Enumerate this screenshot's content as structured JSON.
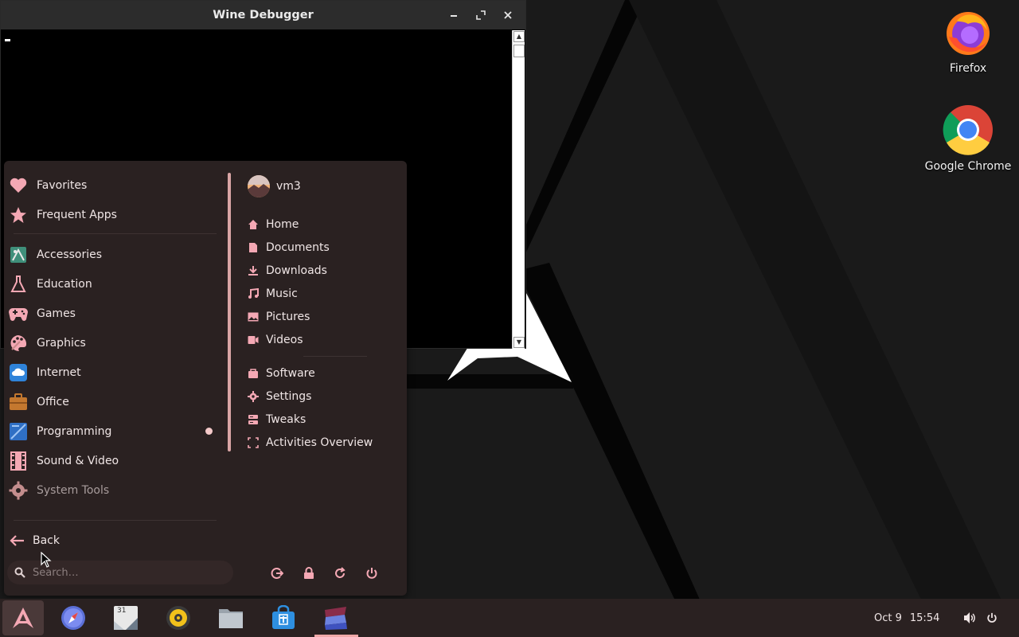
{
  "desktop": {
    "icons": [
      {
        "label": "Firefox",
        "icon": "firefox-icon"
      },
      {
        "label": "Google Chrome",
        "icon": "chrome-icon"
      }
    ]
  },
  "wine_window": {
    "title": "Wine Debugger",
    "controls": [
      "minimize",
      "maximize",
      "close"
    ]
  },
  "app_menu": {
    "categories": [
      {
        "label": "Favorites",
        "icon": "heart-icon"
      },
      {
        "label": "Frequent Apps",
        "icon": "star-icon"
      },
      {
        "label": "Accessories",
        "icon": "accessories-icon"
      },
      {
        "label": "Education",
        "icon": "flask-icon"
      },
      {
        "label": "Games",
        "icon": "gamepad-icon"
      },
      {
        "label": "Graphics",
        "icon": "palette-icon"
      },
      {
        "label": "Internet",
        "icon": "cloud-icon"
      },
      {
        "label": "Office",
        "icon": "briefcase-icon"
      },
      {
        "label": "Programming",
        "icon": "programming-icon"
      },
      {
        "label": "Sound & Video",
        "icon": "film-icon"
      },
      {
        "label": "System Tools",
        "icon": "gear-icon"
      }
    ],
    "user": {
      "name": "vm3"
    },
    "places": [
      {
        "label": "Home",
        "icon": "home-icon"
      },
      {
        "label": "Documents",
        "icon": "document-icon"
      },
      {
        "label": "Downloads",
        "icon": "download-icon"
      },
      {
        "label": "Music",
        "icon": "music-icon"
      },
      {
        "label": "Pictures",
        "icon": "picture-icon"
      },
      {
        "label": "Videos",
        "icon": "video-icon"
      }
    ],
    "system": [
      {
        "label": "Software",
        "icon": "bag-icon"
      },
      {
        "label": "Settings",
        "icon": "settings-icon"
      },
      {
        "label": "Tweaks",
        "icon": "tweaks-icon"
      },
      {
        "label": "Activities Overview",
        "icon": "overview-icon"
      }
    ],
    "back_label": "Back",
    "search_placeholder": "Search…",
    "session_buttons": [
      "logout-icon",
      "lock-icon",
      "restart-icon",
      "power-icon"
    ]
  },
  "taskbar": {
    "apps": [
      "app-menu-icon",
      "compass-icon",
      "calendar-icon",
      "rhythmbox-icon",
      "files-icon",
      "software-store-icon",
      "wine-icon"
    ],
    "calendar_day": "31",
    "clock_date": "Oct 9",
    "clock_time": "15:54",
    "tray": [
      "volume-icon",
      "power-icon"
    ]
  },
  "colors": {
    "accent": "#f0a8a8",
    "menu_bg": "#2a2121",
    "taskbar_bg": "#2a2121"
  }
}
